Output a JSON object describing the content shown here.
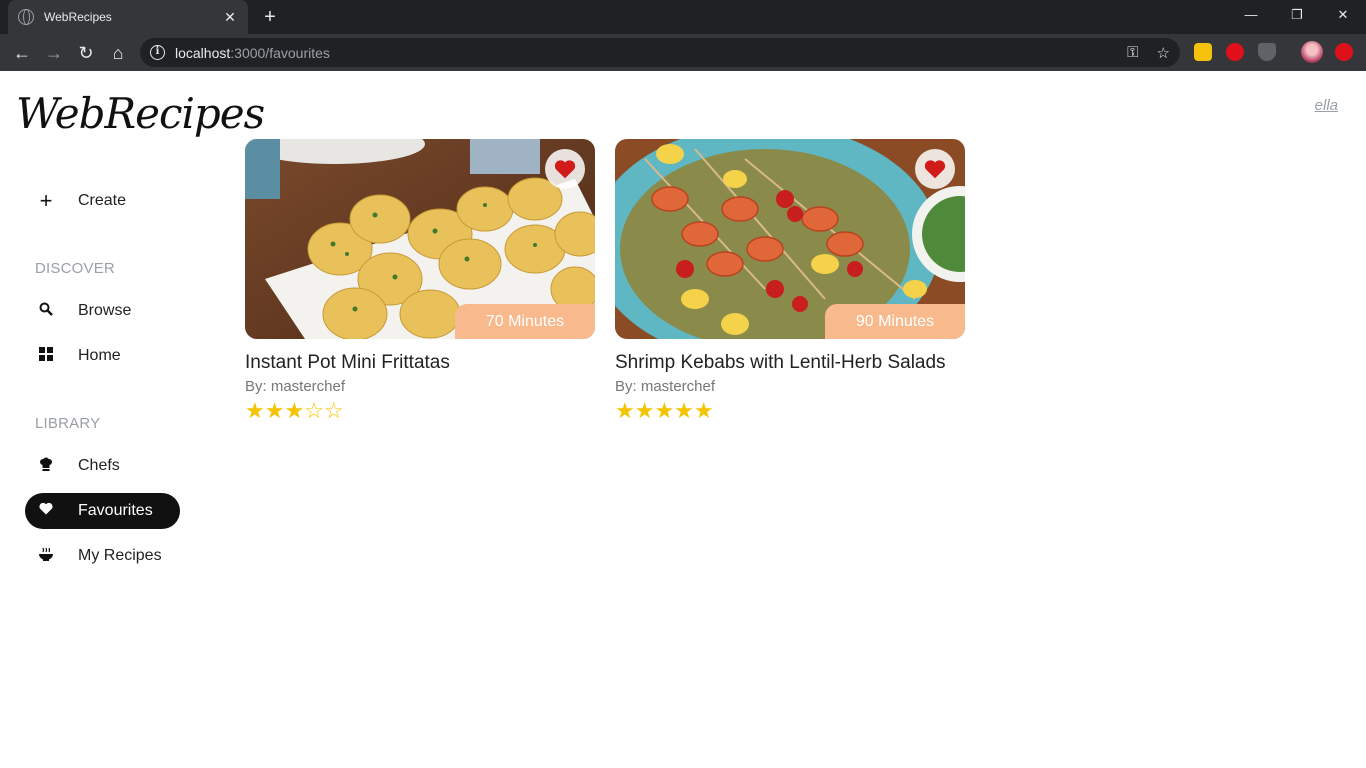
{
  "browser": {
    "tab_title": "WebRecipes",
    "tab_close": "✕",
    "new_tab": "+",
    "minimize": "—",
    "restore": "❐",
    "close": "✕",
    "url_host": "localhost",
    "url_path": ":3000/favourites",
    "info_glyph": "i",
    "key_glyph": "⚿",
    "star_glyph": "☆"
  },
  "header": {
    "logo": "WebRecipes",
    "user": "ella"
  },
  "sidebar": {
    "create": {
      "label": "Create",
      "icon": "plus-icon",
      "glyph": "+"
    },
    "discover_label": "DISCOVER",
    "browse": {
      "label": "Browse",
      "icon": "search-icon",
      "glyph": "🔍"
    },
    "home": {
      "label": "Home",
      "icon": "grid-icon",
      "glyph": "▦"
    },
    "library_label": "LIBRARY",
    "chefs": {
      "label": "Chefs",
      "icon": "chef-hat-icon",
      "glyph": "♛"
    },
    "favourites": {
      "label": "Favourites",
      "icon": "heart-icon",
      "glyph": "♥"
    },
    "my_recipes": {
      "label": "My Recipes",
      "icon": "bowl-icon",
      "glyph": "♨"
    }
  },
  "recipes": [
    {
      "title": "Instant Pot Mini Frittatas",
      "author": "By: masterchef",
      "time": "70 Minutes",
      "rating": 3,
      "max_rating": 5,
      "stars": "★★★☆☆",
      "favourited": true
    },
    {
      "title": "Shrimp Kebabs with Lentil-Herb Salads",
      "author": "By: masterchef",
      "time": "90 Minutes",
      "rating": 5,
      "max_rating": 5,
      "stars": "★★★★★",
      "favourited": true
    }
  ],
  "colors": {
    "accent": "#111111",
    "badge": "#f8b98c",
    "star": "#f5c400",
    "heart": "#d11a1a"
  }
}
